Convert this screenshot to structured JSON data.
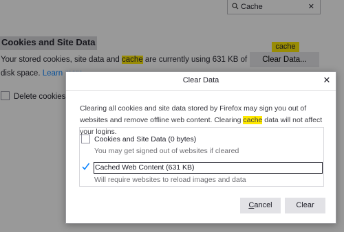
{
  "background": {
    "search": {
      "value": "Cache"
    },
    "section_title": "Cookies and Site Data",
    "desc_part1": "Your stored cookies, site data and ",
    "desc_highlight": "cache",
    "desc_part2": " are currently using 631 KB of disk space. ",
    "learn_more": "Learn more",
    "cache_tag": "cache",
    "clear_data_button": "Clear Data...",
    "delete_label": "Delete cookies a"
  },
  "dialog": {
    "title": "Clear Data",
    "desc_part1": "Clearing all cookies and site data stored by Firefox may sign you out of websites and remove offline web content. Clearing ",
    "desc_highlight": "cache",
    "desc_part2": " data will not affect your logins.",
    "options": [
      {
        "label": "Cookies and Site Data (0 bytes)",
        "sub": "You may get signed out of websites if cleared",
        "checked": false
      },
      {
        "label": "Cached Web Content (631 KB)",
        "sub": "Will require websites to reload images and data",
        "checked": true
      }
    ],
    "cancel_accesskey": "C",
    "cancel_rest": "ancel",
    "clear_button": "Clear"
  },
  "colors": {
    "highlight": "#ffe900",
    "link": "#0a84ff",
    "check": "#0a84ff"
  }
}
